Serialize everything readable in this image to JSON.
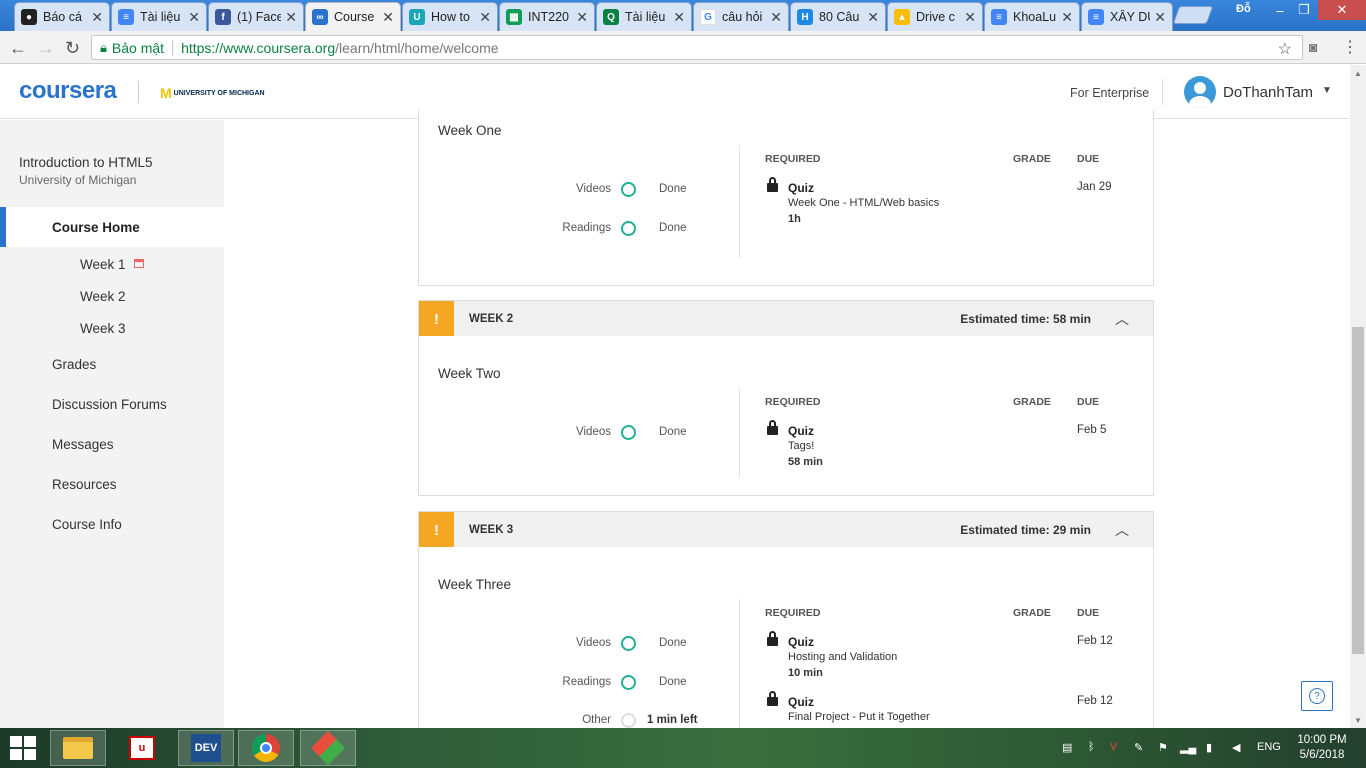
{
  "browser": {
    "tabs": [
      {
        "label": "Báo cá",
        "icon": "github-icon"
      },
      {
        "label": "Tài liệu",
        "icon": "docs-icon"
      },
      {
        "label": "(1) Face",
        "icon": "facebook-icon"
      },
      {
        "label": "Course",
        "icon": "coursera-icon"
      },
      {
        "label": "How to",
        "icon": "udemy-icon"
      },
      {
        "label": "INT220",
        "icon": "sheets-icon"
      },
      {
        "label": "Tài liệu",
        "icon": "search-doc-icon"
      },
      {
        "label": "câu hỏi",
        "icon": "google-icon"
      },
      {
        "label": "80 Câu",
        "icon": "h-icon"
      },
      {
        "label": "Drive c",
        "icon": "drive-icon"
      },
      {
        "label": "KhoaLu",
        "icon": "docs-icon"
      },
      {
        "label": "XÂY DỰ",
        "icon": "docs-icon"
      }
    ],
    "profile_label": "Đỗ",
    "secure_label": "Bảo mật",
    "url_host": "https://www.coursera.org",
    "url_path": "/learn/html/home/welcome"
  },
  "header": {
    "logo": "coursera",
    "partner": "UNIVERSITY OF MICHIGAN",
    "enterprise": "For Enterprise",
    "username": "DoThanhTam"
  },
  "sidebar": {
    "course_title": "Introduction to HTML5",
    "course_sub": "University of Michigan",
    "home": "Course Home",
    "weeks": [
      "Week 1",
      "Week 2",
      "Week 3"
    ],
    "items": [
      "Grades",
      "Discussion Forums",
      "Messages",
      "Resources",
      "Course Info"
    ]
  },
  "columns": {
    "required": "REQUIRED",
    "grade": "GRADE",
    "due": "DUE"
  },
  "status_done": "Done",
  "week1": {
    "name": "Week One",
    "progress": [
      {
        "label": "Videos",
        "status": "Done"
      },
      {
        "label": "Readings",
        "status": "Done"
      }
    ],
    "quiz": {
      "type": "Quiz",
      "name": "Week One - HTML/Web basics",
      "time": "1h",
      "due": "Jan 29"
    }
  },
  "week2": {
    "label": "WEEK 2",
    "estimate": "Estimated time: 58 min",
    "name": "Week Two",
    "progress": [
      {
        "label": "Videos",
        "status": "Done"
      }
    ],
    "quiz": {
      "type": "Quiz",
      "name": "Tags!",
      "time": "58 min",
      "due": "Feb 5"
    }
  },
  "week3": {
    "label": "WEEK 3",
    "estimate": "Estimated time: 29 min",
    "name": "Week Three",
    "progress": [
      {
        "label": "Videos",
        "status": "Done"
      },
      {
        "label": "Readings",
        "status": "Done"
      },
      {
        "label": "Other",
        "status": "1 min left"
      }
    ],
    "quizzes": [
      {
        "type": "Quiz",
        "name": "Hosting and Validation",
        "time": "10 min",
        "due": "Feb 12"
      },
      {
        "type": "Quiz",
        "name": "Final Project - Put it Together",
        "due": "Feb 12"
      }
    ]
  },
  "taskbar": {
    "lang": "ENG",
    "time": "10:00 PM",
    "date": "5/6/2018",
    "dev_label": "DEV"
  }
}
